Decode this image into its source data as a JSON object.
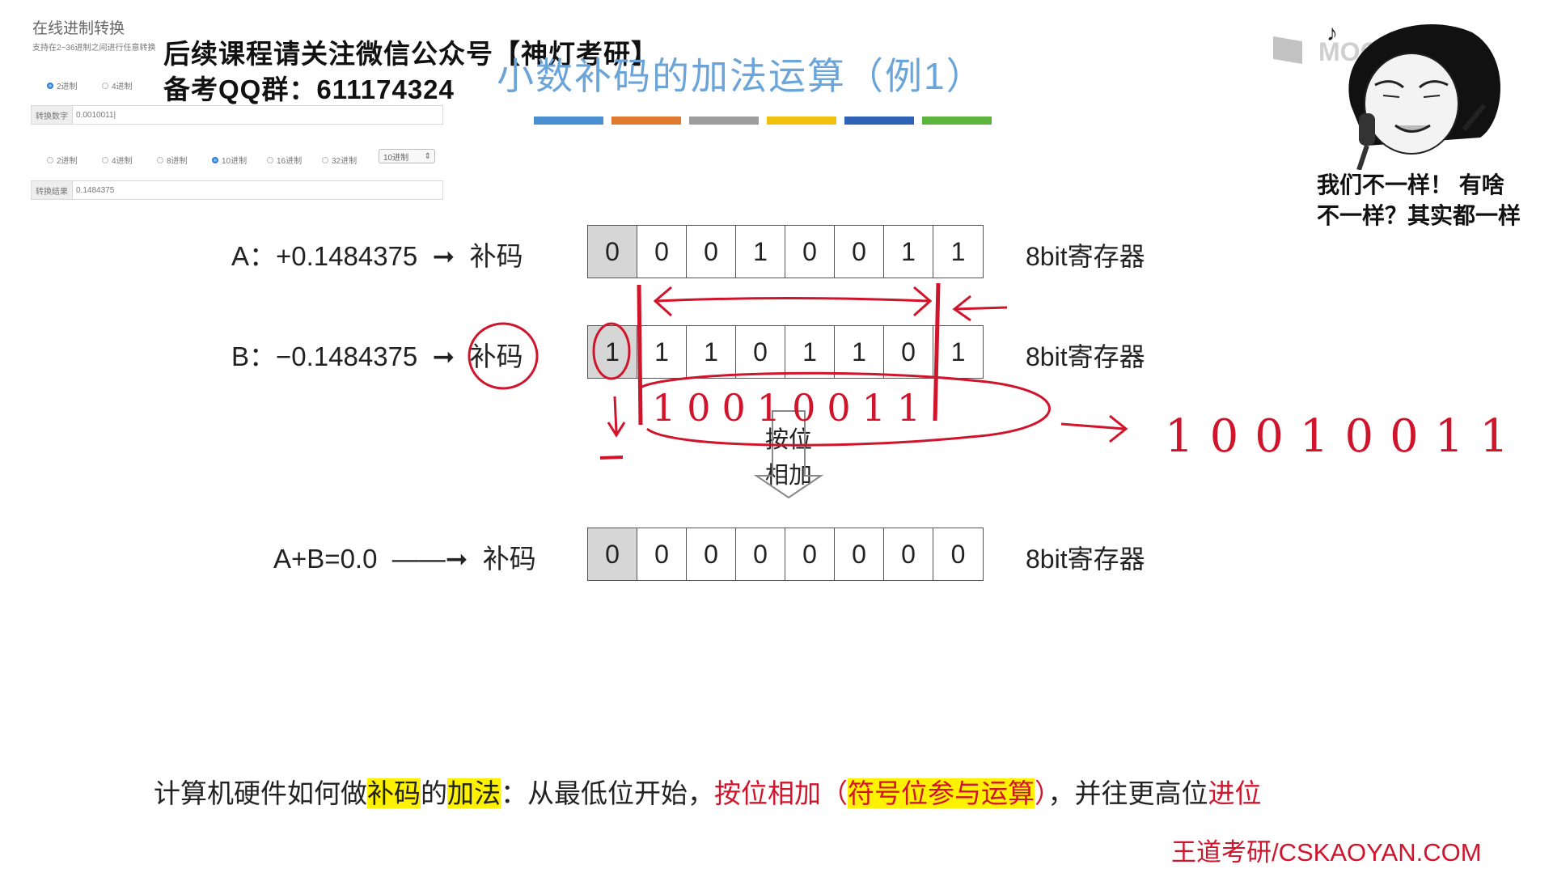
{
  "converter": {
    "title": "在线进制转换",
    "subtitle": "支持在2~36进制之间进行任意转换",
    "input_radios": [
      {
        "label": "2进制",
        "selected": true
      },
      {
        "label": "4进制",
        "selected": false
      }
    ],
    "input_label": "转换数字",
    "input_value": "0.0010011|",
    "output_radios": [
      {
        "label": "2进制",
        "selected": false
      },
      {
        "label": "4进制",
        "selected": false
      },
      {
        "label": "8进制",
        "selected": false
      },
      {
        "label": "10进制",
        "selected": true
      },
      {
        "label": "16进制",
        "selected": false
      },
      {
        "label": "32进制",
        "selected": false
      }
    ],
    "output_select": "10进制",
    "result_label": "转换结果",
    "result_value": "0.1484375"
  },
  "watermark": {
    "line1": "后续课程请关注微信公众号【神灯考研】",
    "line2": "备考QQ群：611174324"
  },
  "slide": {
    "title": "小数补码的加法运算（例1）",
    "stripe_colors": [
      "#4a8fd1",
      "#e07a2e",
      "#9e9e9e",
      "#f2c00f",
      "#2f63b8",
      "#5cb53c"
    ],
    "brand": "MOOC",
    "meme_caption_line1": "我们不一样！ 有啥",
    "meme_caption_line2": "不一样？其实都一样",
    "rows": [
      {
        "label": "A：+0.1484375",
        "target": "补码",
        "bits": [
          "0",
          "0",
          "0",
          "1",
          "0",
          "0",
          "1",
          "1"
        ],
        "register": "8bit寄存器"
      },
      {
        "label": "B：−0.1484375",
        "target": "补码",
        "bits": [
          "1",
          "1",
          "1",
          "0",
          "1",
          "1",
          "0",
          "1"
        ],
        "register": "8bit寄存器"
      },
      {
        "label": "A+B=0.0",
        "target": "补码",
        "bits": [
          "0",
          "0",
          "0",
          "0",
          "0",
          "0",
          "0",
          "0"
        ],
        "register": "8bit寄存器"
      }
    ],
    "add_label_1": "按位",
    "add_label_2": "相加",
    "handwritten_bits": "10010011",
    "note": {
      "p1": "计算机硬件如何做",
      "p2": "补码",
      "p3": "的",
      "p4": "加法",
      "p5": "：从最低位开始，",
      "p6": "按位相加（",
      "p7": "符号位参与运算",
      "p8": "）",
      "p9": "，并往更高位",
      "p10": "进位"
    },
    "credit": "王道考研/CSKAOYAN.COM"
  }
}
